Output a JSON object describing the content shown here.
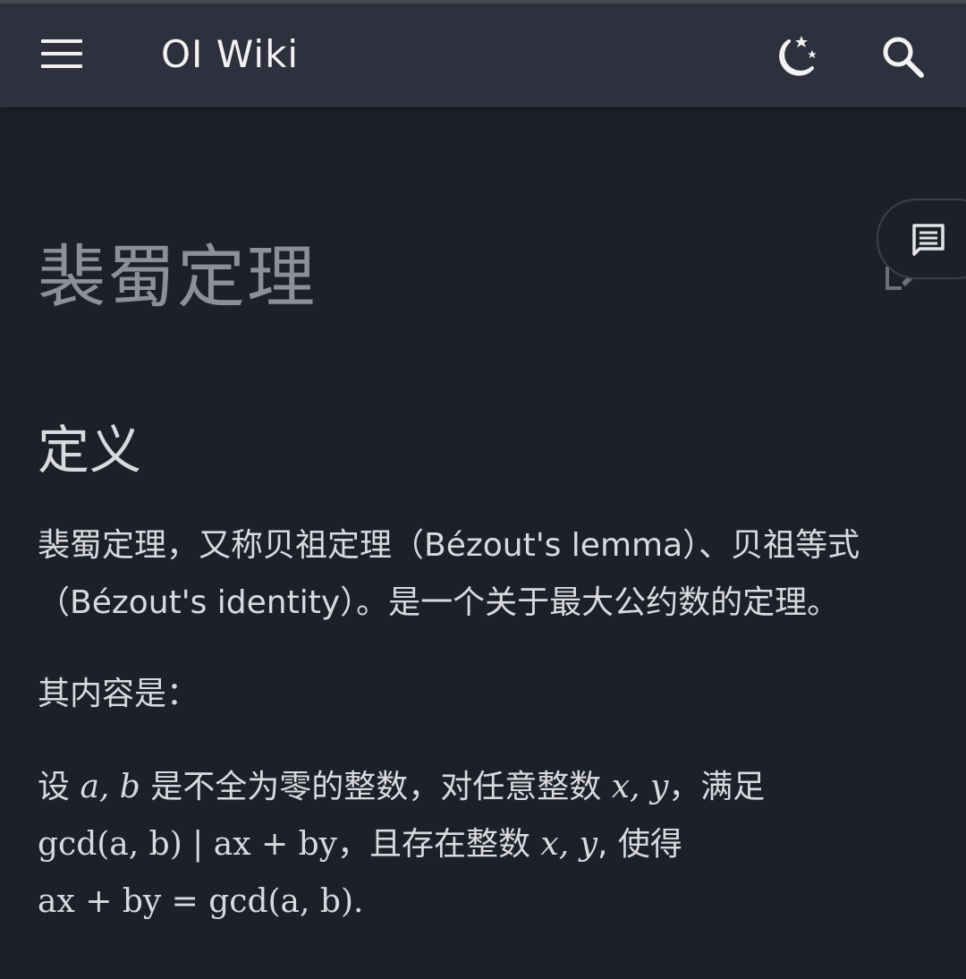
{
  "header": {
    "site_title": "OI Wiki",
    "menu_icon": "hamburger-menu-icon",
    "theme_icon": "moon-stars-icon",
    "search_icon": "search-icon"
  },
  "page": {
    "title": "裴蜀定理",
    "edit_icon": "edit-icon",
    "comments_icon": "comment-icon"
  },
  "section": {
    "heading": "定义",
    "p1_line1": "裴蜀定理，又称贝祖定理（Bézout's lemma）、贝祖等式",
    "p1_line2": "（Bézout's identity）。是一个关于最大公约数的定理。",
    "p2": "其内容是：",
    "p3": {
      "l1_a": "设 ",
      "l1_m1": "a, b",
      "l1_b": " 是不全为零的整数，对任意整数 ",
      "l1_m2": "x, y",
      "l1_c": "，满足",
      "l2_m1": "gcd(a, b) | ax + by",
      "l2_a": "，且存在整数 ",
      "l2_m2": "x, y",
      "l2_b": ", 使得",
      "l3_m1": "ax + by = gcd(a, b)."
    }
  },
  "colors": {
    "appbar": "#2e303e",
    "background": "#1e2029",
    "title": "#8e9097",
    "text": "#d9dadf"
  }
}
